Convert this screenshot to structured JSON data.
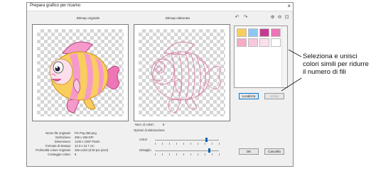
{
  "window": {
    "title": "Prepara grafico per ricamo",
    "close_glyph": "×"
  },
  "captions": {
    "original": "Bitmap originale",
    "processed": "Bitmap elaborata"
  },
  "toolbar": {
    "undo_icon": "undo-icon",
    "redo_icon": "redo-icon",
    "zoom_in_icon": "zoom-in-icon",
    "zoom_out_icon": "zoom-out-icon",
    "zoom_fit_icon": "zoom-fit-icon"
  },
  "swatches": [
    "#f9cd5e",
    "#8ec8f2",
    "#c43c8f",
    "#ec74b7",
    "#f8a9c6",
    "#f6c8de",
    "#fbe0ec",
    "#ffffff"
  ],
  "buttons": {
    "localize": "Localizza",
    "merge": "Unisci",
    "ok": "OK",
    "cancel": "Cancella"
  },
  "num_colors": {
    "label": "Num. di colori:",
    "value": "8"
  },
  "options": {
    "title": "Opzioni di elaborazione",
    "colors_label": "Colori",
    "details_label": "Dettaglio",
    "colors_level": 0.8,
    "details_level": 0.85
  },
  "info": [
    {
      "label": "Nome file originale:",
      "value": "Pic Png 256.png"
    },
    {
      "label": "Definizione:",
      "value": "256 x 256 DPI"
    },
    {
      "label": "Dimensione:",
      "value": "1240 x 1097 Pixels"
    },
    {
      "label": "Formato di stampa:",
      "value": "12.3 x 12.7 cm"
    },
    {
      "label": "Profondità colore originale:",
      "value": "256 colori (8 bit per pixel)"
    },
    {
      "label": "Conteggio colore:",
      "value": "8"
    }
  ],
  "callout": {
    "text": "Seleziona e unisci colori simili per ridurre il numero di fili"
  }
}
